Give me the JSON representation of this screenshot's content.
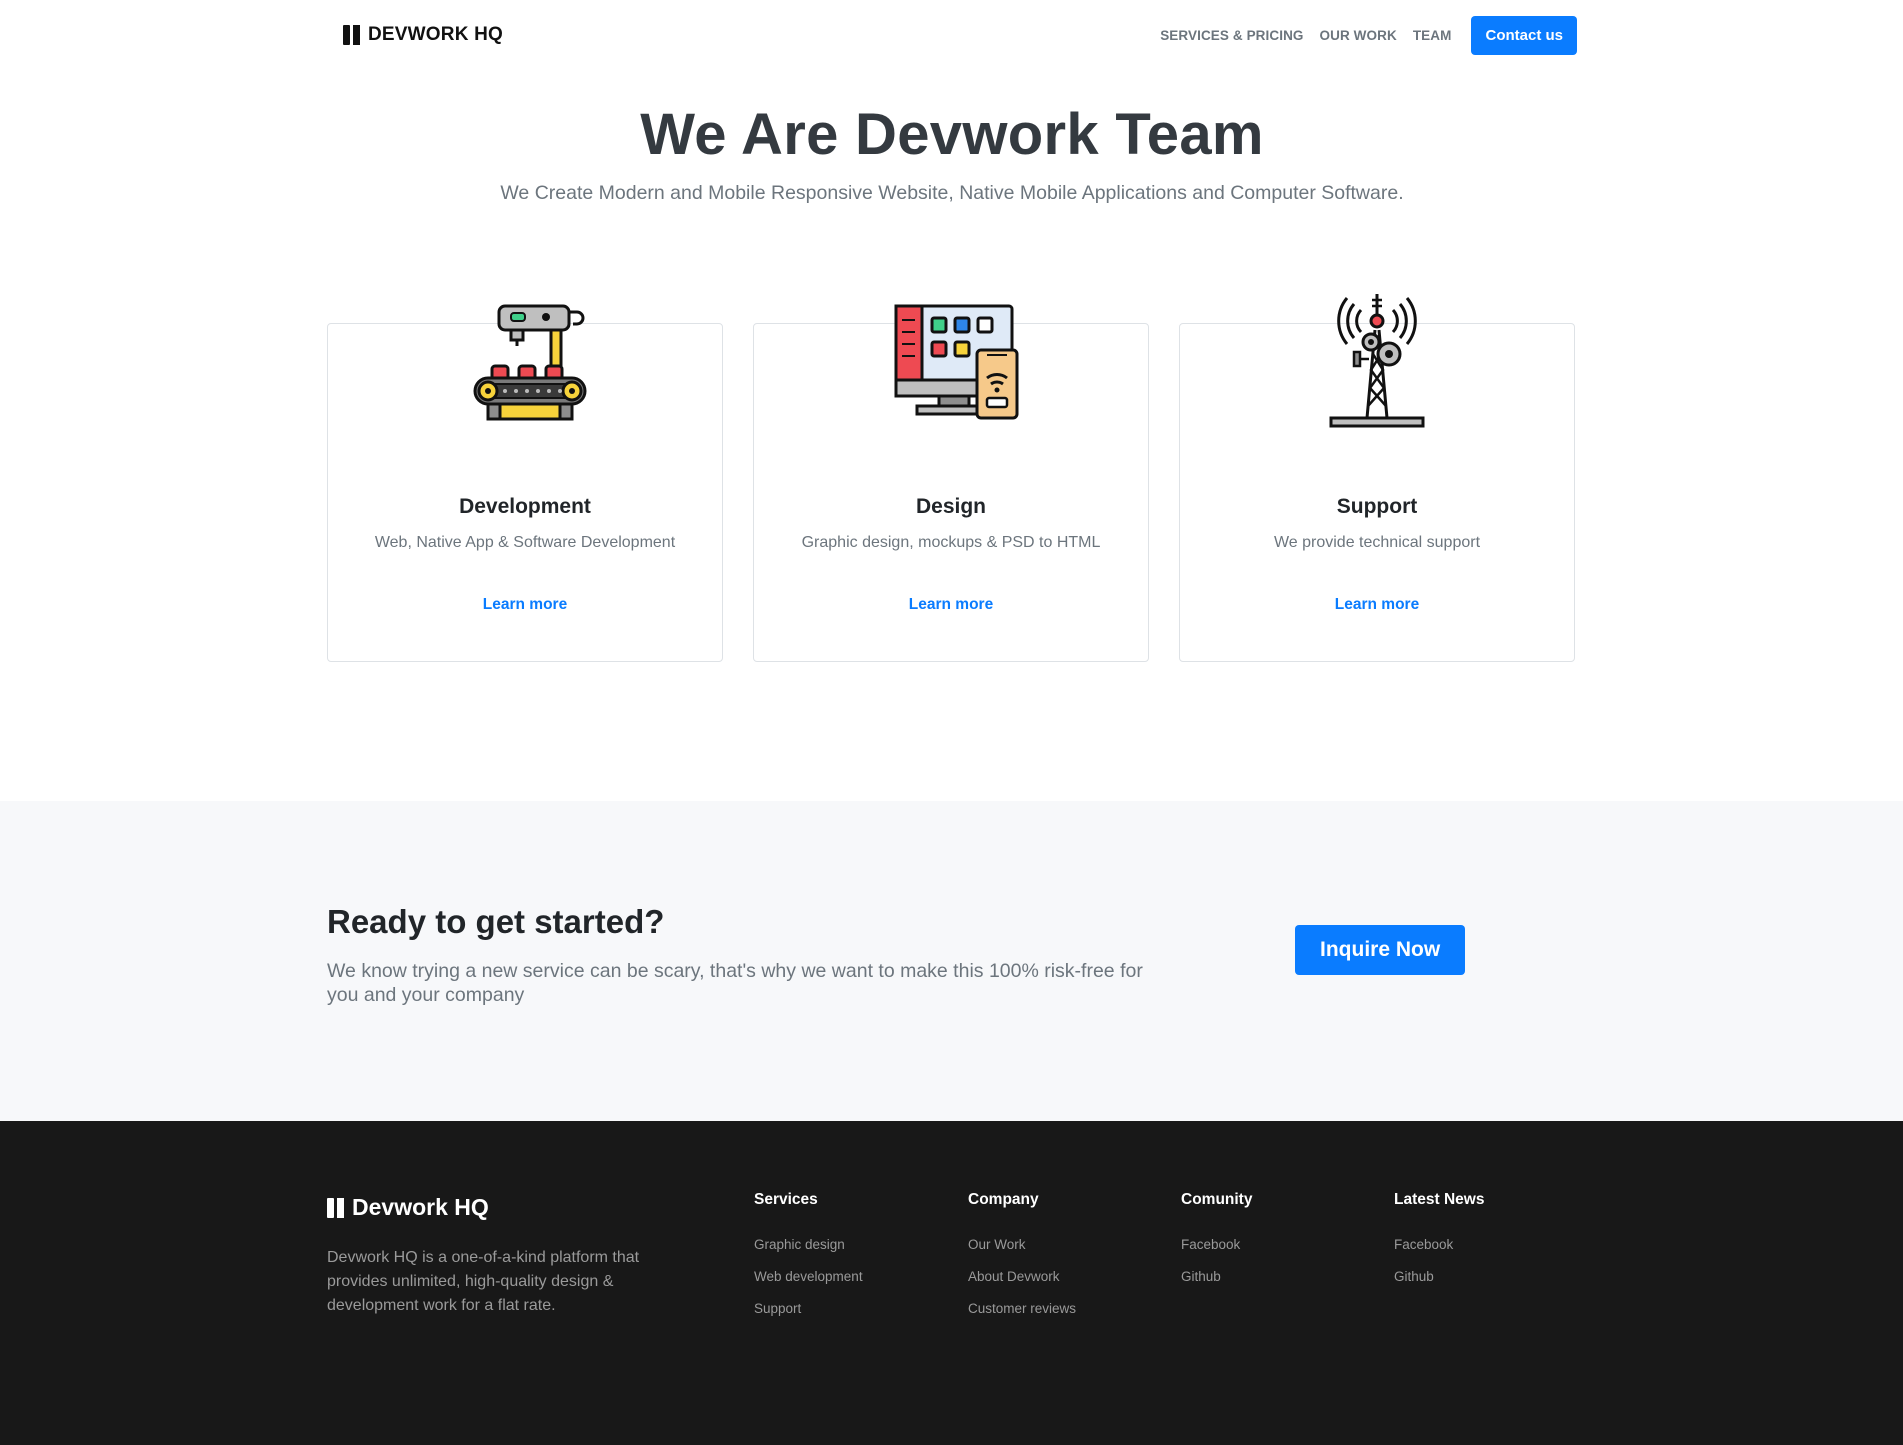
{
  "nav": {
    "brand": "DEVWORK HQ",
    "links": [
      "SERVICES & PRICING",
      "OUR WORK",
      "TEAM"
    ],
    "contact_label": "Contact us"
  },
  "hero": {
    "title": "We Are Devwork Team",
    "subtitle": "We Create Modern and Mobile Responsive Website, Native Mobile Applications and Computer Software."
  },
  "services": [
    {
      "icon": "robotic-conveyor-icon",
      "title": "Development",
      "desc": "Web, Native App & Software Development",
      "link": "Learn more"
    },
    {
      "icon": "monitor-phone-icon",
      "title": "Design",
      "desc": "Graphic design, mockups & PSD to HTML",
      "link": "Learn more"
    },
    {
      "icon": "signal-tower-icon",
      "title": "Support",
      "desc": "We provide technical support",
      "link": "Learn more"
    }
  ],
  "cta": {
    "title": "Ready to get started?",
    "text": "We know trying a new service can be scary, that's why we want to make this 100% risk-free for you and your company",
    "button": "Inquire Now"
  },
  "footer": {
    "brand": "Devwork HQ",
    "about": "Devwork HQ is a one-of-a-kind platform that provides unlimited, high-quality design & development work for a flat rate.",
    "columns": [
      {
        "title": "Services",
        "items": [
          "Graphic design",
          "Web development",
          "Support"
        ]
      },
      {
        "title": "Company",
        "items": [
          "Our Work",
          "About Devwork",
          "Customer reviews"
        ]
      },
      {
        "title": "Comunity",
        "items": [
          "Facebook",
          "Github"
        ]
      },
      {
        "title": "Latest News",
        "items": [
          "Facebook",
          "Github"
        ]
      }
    ]
  },
  "colors": {
    "accent": "#0a7cff",
    "heading": "#343a40",
    "muted": "#6c757d",
    "cta_bg": "#f7f8fa",
    "footer_bg": "#181818"
  }
}
